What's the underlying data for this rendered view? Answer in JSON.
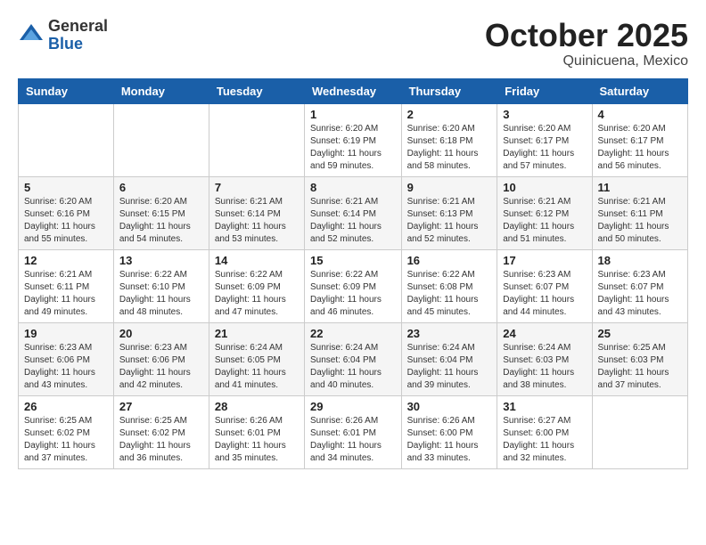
{
  "logo": {
    "general": "General",
    "blue": "Blue"
  },
  "title": "October 2025",
  "subtitle": "Quinicuena, Mexico",
  "days_of_week": [
    "Sunday",
    "Monday",
    "Tuesday",
    "Wednesday",
    "Thursday",
    "Friday",
    "Saturday"
  ],
  "weeks": [
    [
      {
        "day": "",
        "info": ""
      },
      {
        "day": "",
        "info": ""
      },
      {
        "day": "",
        "info": ""
      },
      {
        "day": "1",
        "info": "Sunrise: 6:20 AM\nSunset: 6:19 PM\nDaylight: 11 hours\nand 59 minutes."
      },
      {
        "day": "2",
        "info": "Sunrise: 6:20 AM\nSunset: 6:18 PM\nDaylight: 11 hours\nand 58 minutes."
      },
      {
        "day": "3",
        "info": "Sunrise: 6:20 AM\nSunset: 6:17 PM\nDaylight: 11 hours\nand 57 minutes."
      },
      {
        "day": "4",
        "info": "Sunrise: 6:20 AM\nSunset: 6:17 PM\nDaylight: 11 hours\nand 56 minutes."
      }
    ],
    [
      {
        "day": "5",
        "info": "Sunrise: 6:20 AM\nSunset: 6:16 PM\nDaylight: 11 hours\nand 55 minutes."
      },
      {
        "day": "6",
        "info": "Sunrise: 6:20 AM\nSunset: 6:15 PM\nDaylight: 11 hours\nand 54 minutes."
      },
      {
        "day": "7",
        "info": "Sunrise: 6:21 AM\nSunset: 6:14 PM\nDaylight: 11 hours\nand 53 minutes."
      },
      {
        "day": "8",
        "info": "Sunrise: 6:21 AM\nSunset: 6:14 PM\nDaylight: 11 hours\nand 52 minutes."
      },
      {
        "day": "9",
        "info": "Sunrise: 6:21 AM\nSunset: 6:13 PM\nDaylight: 11 hours\nand 52 minutes."
      },
      {
        "day": "10",
        "info": "Sunrise: 6:21 AM\nSunset: 6:12 PM\nDaylight: 11 hours\nand 51 minutes."
      },
      {
        "day": "11",
        "info": "Sunrise: 6:21 AM\nSunset: 6:11 PM\nDaylight: 11 hours\nand 50 minutes."
      }
    ],
    [
      {
        "day": "12",
        "info": "Sunrise: 6:21 AM\nSunset: 6:11 PM\nDaylight: 11 hours\nand 49 minutes."
      },
      {
        "day": "13",
        "info": "Sunrise: 6:22 AM\nSunset: 6:10 PM\nDaylight: 11 hours\nand 48 minutes."
      },
      {
        "day": "14",
        "info": "Sunrise: 6:22 AM\nSunset: 6:09 PM\nDaylight: 11 hours\nand 47 minutes."
      },
      {
        "day": "15",
        "info": "Sunrise: 6:22 AM\nSunset: 6:09 PM\nDaylight: 11 hours\nand 46 minutes."
      },
      {
        "day": "16",
        "info": "Sunrise: 6:22 AM\nSunset: 6:08 PM\nDaylight: 11 hours\nand 45 minutes."
      },
      {
        "day": "17",
        "info": "Sunrise: 6:23 AM\nSunset: 6:07 PM\nDaylight: 11 hours\nand 44 minutes."
      },
      {
        "day": "18",
        "info": "Sunrise: 6:23 AM\nSunset: 6:07 PM\nDaylight: 11 hours\nand 43 minutes."
      }
    ],
    [
      {
        "day": "19",
        "info": "Sunrise: 6:23 AM\nSunset: 6:06 PM\nDaylight: 11 hours\nand 43 minutes."
      },
      {
        "day": "20",
        "info": "Sunrise: 6:23 AM\nSunset: 6:06 PM\nDaylight: 11 hours\nand 42 minutes."
      },
      {
        "day": "21",
        "info": "Sunrise: 6:24 AM\nSunset: 6:05 PM\nDaylight: 11 hours\nand 41 minutes."
      },
      {
        "day": "22",
        "info": "Sunrise: 6:24 AM\nSunset: 6:04 PM\nDaylight: 11 hours\nand 40 minutes."
      },
      {
        "day": "23",
        "info": "Sunrise: 6:24 AM\nSunset: 6:04 PM\nDaylight: 11 hours\nand 39 minutes."
      },
      {
        "day": "24",
        "info": "Sunrise: 6:24 AM\nSunset: 6:03 PM\nDaylight: 11 hours\nand 38 minutes."
      },
      {
        "day": "25",
        "info": "Sunrise: 6:25 AM\nSunset: 6:03 PM\nDaylight: 11 hours\nand 37 minutes."
      }
    ],
    [
      {
        "day": "26",
        "info": "Sunrise: 6:25 AM\nSunset: 6:02 PM\nDaylight: 11 hours\nand 37 minutes."
      },
      {
        "day": "27",
        "info": "Sunrise: 6:25 AM\nSunset: 6:02 PM\nDaylight: 11 hours\nand 36 minutes."
      },
      {
        "day": "28",
        "info": "Sunrise: 6:26 AM\nSunset: 6:01 PM\nDaylight: 11 hours\nand 35 minutes."
      },
      {
        "day": "29",
        "info": "Sunrise: 6:26 AM\nSunset: 6:01 PM\nDaylight: 11 hours\nand 34 minutes."
      },
      {
        "day": "30",
        "info": "Sunrise: 6:26 AM\nSunset: 6:00 PM\nDaylight: 11 hours\nand 33 minutes."
      },
      {
        "day": "31",
        "info": "Sunrise: 6:27 AM\nSunset: 6:00 PM\nDaylight: 11 hours\nand 32 minutes."
      },
      {
        "day": "",
        "info": ""
      }
    ]
  ]
}
